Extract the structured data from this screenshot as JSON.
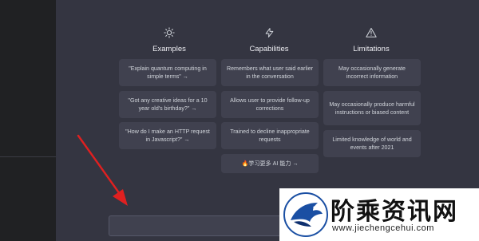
{
  "columns": [
    {
      "id": "examples",
      "icon": "sun-icon",
      "title": "Examples",
      "cards": [
        "\"Explain quantum computing in simple terms\" →",
        "\"Got any creative ideas for a 10 year old's birthday?\" →",
        "\"How do I make an HTTP request in Javascript?\" →"
      ]
    },
    {
      "id": "capabilities",
      "icon": "lightning-icon",
      "title": "Capabilities",
      "cards": [
        "Remembers what user said earlier in the conversation",
        "Allows user to provide follow-up corrections",
        "Trained to decline inappropriate requests",
        "🔥学习更多  AI 能力 →"
      ]
    },
    {
      "id": "limitations",
      "icon": "warning-icon",
      "title": "Limitations",
      "cards": [
        "May occasionally generate incorrect information",
        "May occasionally produce harmful instructions or biased content",
        "Limited knowledge of world and events after 2021"
      ]
    }
  ],
  "input": {
    "value": "",
    "placeholder": ""
  },
  "annotation": {
    "arrow_color": "#e02020"
  },
  "watermark": {
    "name": "阶乘资讯网",
    "url": "www.jiechengcehui.com",
    "icon": "eagle-logo"
  },
  "colors": {
    "background": "#343541",
    "sidebar": "#202123",
    "card": "#40414f",
    "text": "#ececf1"
  }
}
